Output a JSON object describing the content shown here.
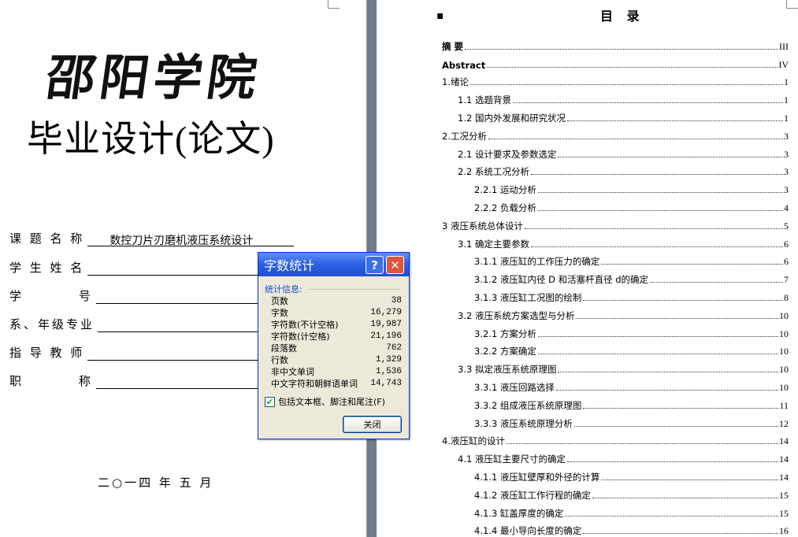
{
  "cover": {
    "logo_text": "邵阳学院",
    "title": "毕业设计(论文)",
    "fields": [
      {
        "label": "课 题 名 称",
        "value": "数控刀片刃磨机液压系统设计"
      },
      {
        "label": "学 生 姓 名",
        "value": ""
      },
      {
        "label": "学         号",
        "value": ""
      },
      {
        "label": "系、年级专业",
        "value": ""
      },
      {
        "label": "指 导 教 师",
        "value": ""
      },
      {
        "label": "职         称",
        "value": ""
      }
    ],
    "date": "二○一四 年 五 月"
  },
  "toc": {
    "title": "目 录",
    "entries": [
      {
        "level": 1,
        "text": "摘  要",
        "page": "III"
      },
      {
        "level": 1,
        "text": "Abstract",
        "page": "IV"
      },
      {
        "level": 1,
        "text": "1.绪论",
        "page": "1"
      },
      {
        "level": 2,
        "text": "1.1  选题背景",
        "page": "1"
      },
      {
        "level": 2,
        "text": "1.2 国内外发展和研究状况",
        "page": "1"
      },
      {
        "level": 1,
        "text": "2.工况分析",
        "page": "3"
      },
      {
        "level": 2,
        "text": "2.1 设计要求及参数选定",
        "page": "3"
      },
      {
        "level": 2,
        "text": "2.2 系统工况分析",
        "page": "3"
      },
      {
        "level": 3,
        "text": "2.2.1  运动分析",
        "page": "3"
      },
      {
        "level": 3,
        "text": "2.2.2  负载分析",
        "page": "4"
      },
      {
        "level": 1,
        "text": "3 液压系统总体设计",
        "page": "5"
      },
      {
        "level": 2,
        "text": "3.1 确定主要参数",
        "page": "6"
      },
      {
        "level": 3,
        "text": "3.1.1 液压缸的工作压力的确定",
        "page": "6"
      },
      {
        "level": 3,
        "text": "3.1.2  液压缸内径 D 和活塞杆直径 d的确定",
        "page": "7"
      },
      {
        "level": 3,
        "text": "3.1.3  液压缸工况图的绘制",
        "page": "8"
      },
      {
        "level": 2,
        "text": "3.2 液压系统方案选型与分析",
        "page": "10"
      },
      {
        "level": 3,
        "text": "3.2.1 方案分析",
        "page": "10"
      },
      {
        "level": 3,
        "text": "3.2.2 方案确定",
        "page": "10"
      },
      {
        "level": 2,
        "text": "3.3 拟定液压系统原理图",
        "page": "10"
      },
      {
        "level": 3,
        "text": "3.3.1 液压回路选择",
        "page": "10"
      },
      {
        "level": 3,
        "text": "3.3.2 组成液压系统原理图",
        "page": "11"
      },
      {
        "level": 3,
        "text": "3.3.3 液压系统原理分析",
        "page": "12"
      },
      {
        "level": 1,
        "text": "4.液压缸的设计",
        "page": "14"
      },
      {
        "level": 2,
        "text": "4.1 液压缸主要尺寸的确定",
        "page": "14"
      },
      {
        "level": 3,
        "text": "4.1.1  液压缸壁厚和外径的计算",
        "page": "14"
      },
      {
        "level": 3,
        "text": "4.1.2  液压缸工作行程的确定",
        "page": "15"
      },
      {
        "level": 3,
        "text": "4.1.3  缸盖厚度的确定",
        "page": "15"
      },
      {
        "level": 3,
        "text": "4.1.4  最小导向长度的确定",
        "page": "16"
      }
    ]
  },
  "dialog": {
    "title": "字数统计",
    "help_glyph": "?",
    "close_glyph": "✕",
    "group_label": "统计信息:",
    "stats": [
      {
        "label": "页数",
        "value": "38"
      },
      {
        "label": "字数",
        "value": "16,279"
      },
      {
        "label": "字符数(不计空格)",
        "value": "19,987"
      },
      {
        "label": "字符数(计空格)",
        "value": "21,196"
      },
      {
        "label": "段落数",
        "value": "762"
      },
      {
        "label": "行数",
        "value": "1,329"
      },
      {
        "label": "非中文单词",
        "value": "1,536"
      },
      {
        "label": "中文字符和朝鲜语单词",
        "value": "14,743"
      }
    ],
    "checkbox_label": "包括文本框、脚注和尾注(F)",
    "checkbox_checked": true,
    "close_button_label": "关闭"
  }
}
